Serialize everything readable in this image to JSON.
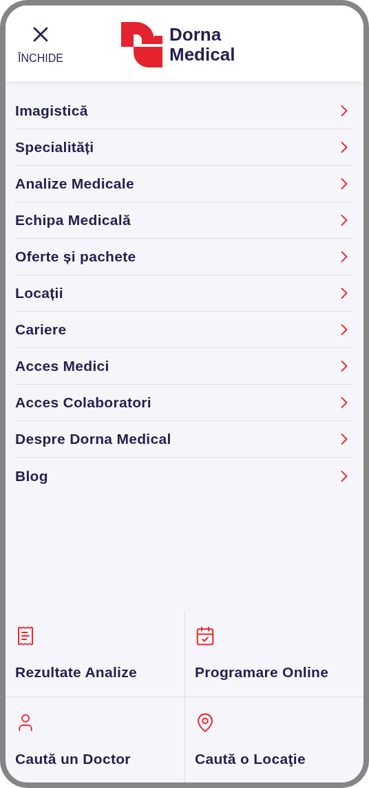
{
  "header": {
    "close_label": "ÎNCHIDE",
    "brand": [
      "Dorna",
      "Medical"
    ]
  },
  "menu": [
    {
      "label": "Imagistică"
    },
    {
      "label": "Specialități"
    },
    {
      "label": "Analize Medicale"
    },
    {
      "label": "Echipa Medicală"
    },
    {
      "label": "Oferte și pachete"
    },
    {
      "label": "Locații"
    },
    {
      "label": "Cariere"
    },
    {
      "label": "Acces Medici"
    },
    {
      "label": "Acces Colaboratori"
    },
    {
      "label": "Despre Dorna Medical"
    },
    {
      "label": "Blog"
    }
  ],
  "shortcuts": [
    {
      "kind": "results",
      "label": "Rezultate Analize"
    },
    {
      "kind": "appointment",
      "label": "Programare Online"
    },
    {
      "kind": "doctor",
      "label": "Caută un Doctor"
    },
    {
      "kind": "location",
      "label": "Caută o Locaţie"
    }
  ]
}
